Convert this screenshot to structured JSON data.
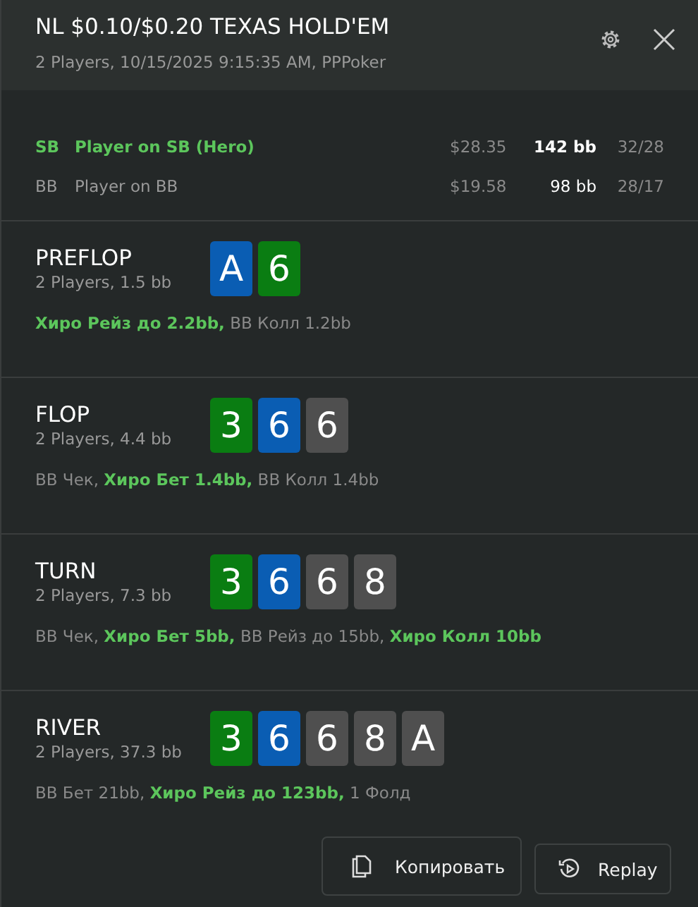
{
  "header": {
    "title": "NL $0.10/$0.20 TEXAS HOLD'EM",
    "subtitle": "2 Players, 10/15/2025 9:15:35 AM, PPPoker"
  },
  "players": [
    {
      "position": "SB",
      "name": "Player on SB (Hero)",
      "hero": true,
      "money": "$28.35",
      "stack": "142 bb",
      "stats": "32/28"
    },
    {
      "position": "BB",
      "name": "Player on BB",
      "hero": false,
      "money": "$19.58",
      "stack": "98 bb",
      "stats": "28/17"
    }
  ],
  "streets": [
    {
      "name": "PREFLOP",
      "info": "2 Players, 1.5 bb",
      "cards": [
        {
          "rank": "A",
          "color": "#0a5db3"
        },
        {
          "rank": "6",
          "color": "#0a7d12"
        }
      ],
      "actions": "**Хиро Рейз до 2.2bb,** BB Колл 1.2bb"
    },
    {
      "name": "FLOP",
      "info": "2 Players, 4.4 bb",
      "cards": [
        {
          "rank": "3",
          "color": "#0a7d12"
        },
        {
          "rank": "6",
          "color": "#0a5db3"
        },
        {
          "rank": "6",
          "color": "#4f4f4f"
        }
      ],
      "actions": "BB Чек, **Хиро Бет 1.4bb,** BB Колл 1.4bb"
    },
    {
      "name": "TURN",
      "info": "2 Players, 7.3 bb",
      "cards": [
        {
          "rank": "3",
          "color": "#0a7d12"
        },
        {
          "rank": "6",
          "color": "#0a5db3"
        },
        {
          "rank": "6",
          "color": "#4f4f4f"
        },
        {
          "rank": "8",
          "color": "#4f4f4f"
        }
      ],
      "actions": "BB Чек, **Хиро Бет 5bb,** BB Рейз до 15bb, **Хиро Колл 10bb**"
    },
    {
      "name": "RIVER",
      "info": "2 Players, 37.3 bb",
      "cards": [
        {
          "rank": "3",
          "color": "#0a7d12"
        },
        {
          "rank": "6",
          "color": "#0a5db3"
        },
        {
          "rank": "6",
          "color": "#4f4f4f"
        },
        {
          "rank": "8",
          "color": "#4f4f4f"
        },
        {
          "rank": "A",
          "color": "#4f4f4f"
        }
      ],
      "actions": "BB Бет 21bb, **Хиро Рейз до 123bb,** 1 Фолд"
    }
  ],
  "buttons": [
    {
      "kind": "copy",
      "label": "Копировать"
    },
    {
      "kind": "replay",
      "label": "Replay"
    }
  ]
}
